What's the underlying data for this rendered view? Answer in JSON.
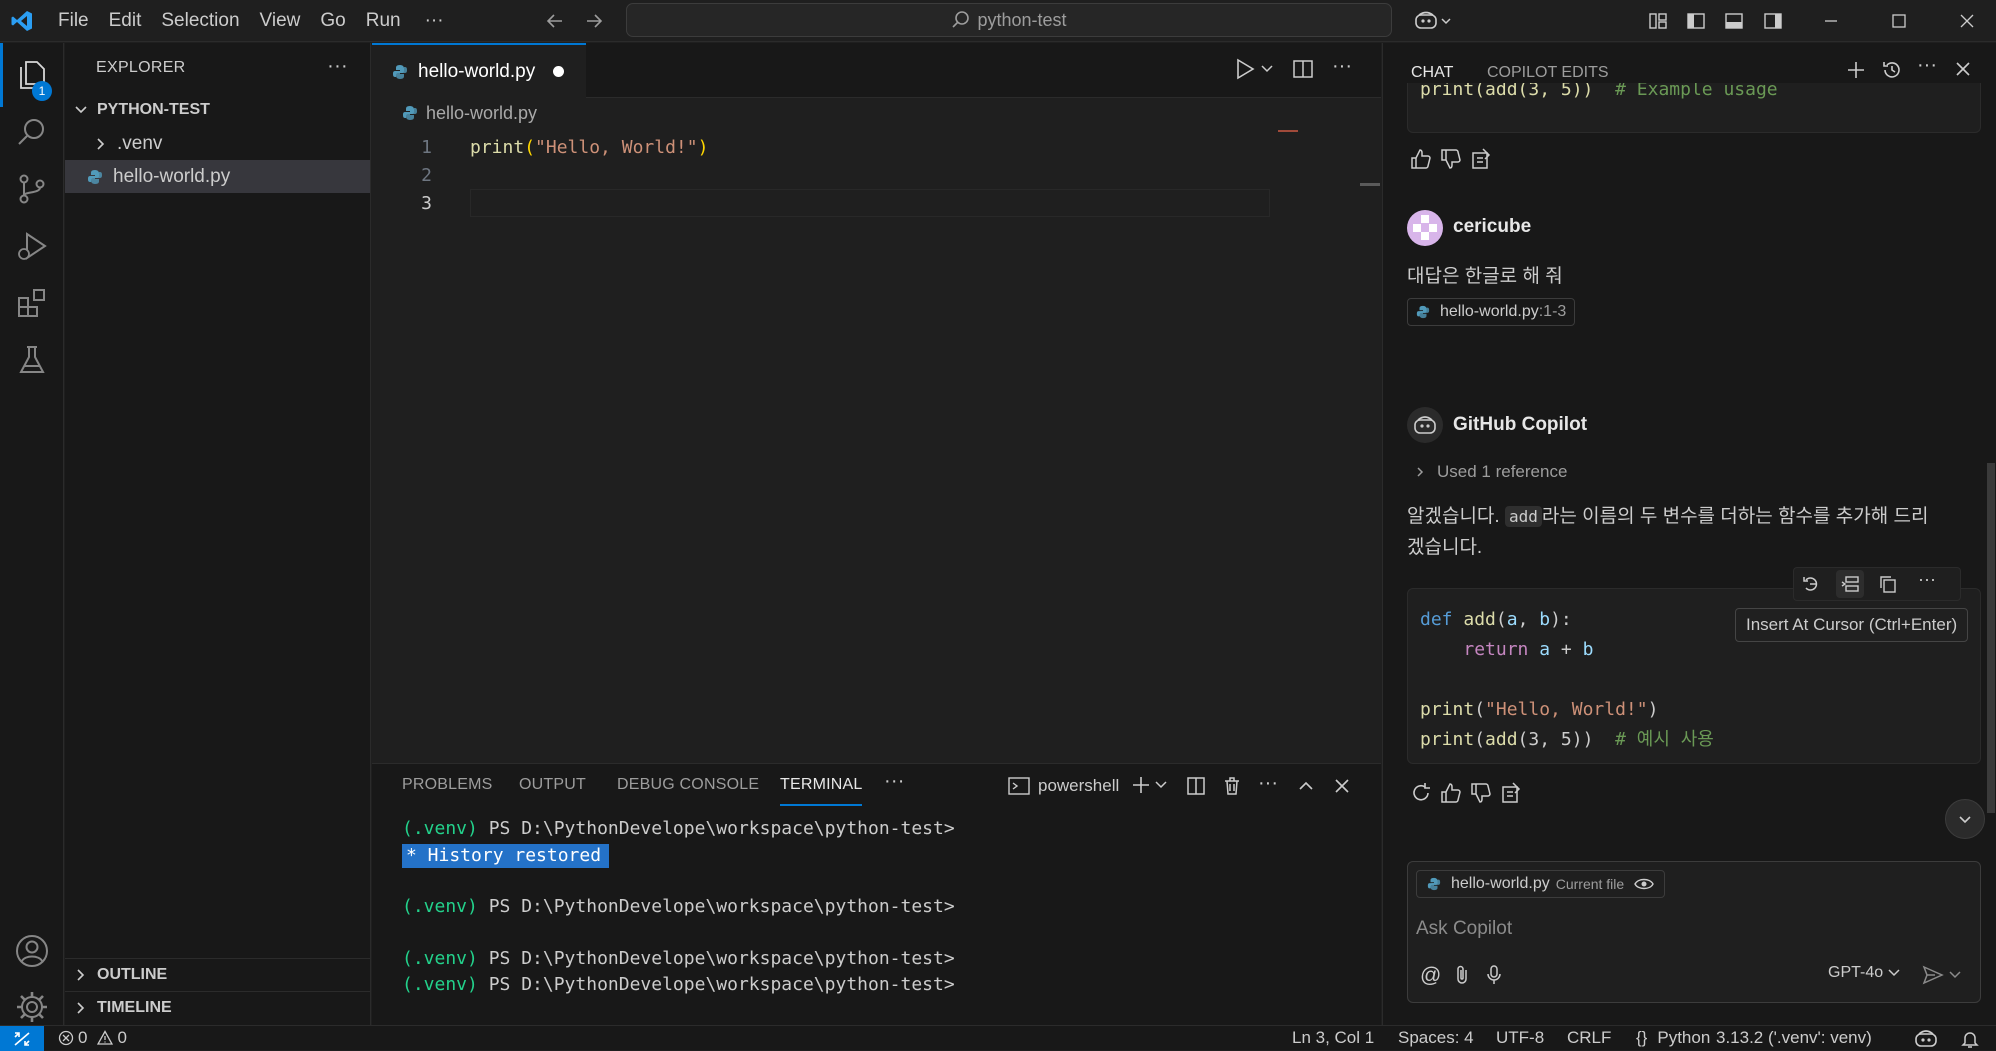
{
  "menu": {
    "file": "File",
    "edit": "Edit",
    "selection": "Selection",
    "view": "View",
    "go": "Go",
    "run": "Run",
    "more": "···"
  },
  "command_center": {
    "text": "python-test"
  },
  "activity": {
    "explorer_badge": "1"
  },
  "sidebar": {
    "title": "EXPLORER",
    "more": "···",
    "folder": "PYTHON-TEST",
    "items": [
      {
        "label": ".venv"
      },
      {
        "label": "hello-world.py"
      }
    ],
    "outline": "OUTLINE",
    "timeline": "TIMELINE"
  },
  "editor": {
    "tab_label": "hello-world.py",
    "breadcrumb": "hello-world.py",
    "lines": [
      {
        "n": "1",
        "code_fn": "print",
        "code_open": "(",
        "code_str": "\"Hello, World!\"",
        "code_close": ")"
      },
      {
        "n": "2"
      },
      {
        "n": "3"
      }
    ]
  },
  "panel": {
    "tabs": [
      "PROBLEMS",
      "OUTPUT",
      "DEBUG CONSOLE",
      "TERMINAL"
    ],
    "more": "···",
    "shell": "powershell",
    "terminal": {
      "prompt_env": "(.venv)",
      "prompt_path": "PS D:\\PythonDevelope\\workspace\\python-test>",
      "history": "* History restored"
    }
  },
  "chat": {
    "tabs": [
      "CHAT",
      "COPILOT EDITS"
    ],
    "top_snippet_fn": "print",
    "top_snippet_args": "(add(3, 5))",
    "top_snippet_comment": "# Example usage",
    "user_name": "cericube",
    "user_message": "대답은 한글로 해 줘",
    "user_ref_file": "hello-world.py",
    "user_ref_lines": ":1-3",
    "bot_name": "GitHub Copilot",
    "used_ref": "Used 1 reference",
    "answer_pre": "알겠습니다.",
    "answer_code": "add",
    "answer_post1": "라는 이름의 두 변수를 더하는 함수를 추가해 드리",
    "answer_post2": "겠습니다.",
    "tooltip": "Insert At Cursor (Ctrl+Enter)",
    "code": {
      "l1_kw": "def",
      "l1_fn": "add",
      "l1_rest1": "(",
      "l1_a": "a",
      "l1_sep": ", ",
      "l1_b": "b",
      "l1_rest2": "):",
      "l2_kw": "return",
      "l2_a": "a",
      "l2_op": " + ",
      "l2_b": "b",
      "l4_fn": "print",
      "l4_open": "(",
      "l4_str": "\"Hello, World!\"",
      "l4_close": ")",
      "l5_fn": "print",
      "l5_open": "(",
      "l5_fn2": "add",
      "l5_args": "(3, 5))",
      "l5_comment": "# 예시 사용"
    },
    "input_file": "hello-world.py",
    "input_file_tag": "Current file",
    "input_placeholder": "Ask Copilot",
    "model": "GPT-4o"
  },
  "status": {
    "errors": "0",
    "warnings": "0",
    "position": "Ln 3, Col 1",
    "spaces": "Spaces: 4",
    "encoding": "UTF-8",
    "eol": "CRLF",
    "lang": "Python",
    "interpreter": "3.13.2 ('.venv': venv)"
  },
  "colors": {
    "accent": "#0078d4",
    "string": "#ce9178",
    "function": "#dcdcaa",
    "keyword": "#569cd6",
    "control": "#c586c0",
    "variable": "#9cdcfe",
    "comment": "#6a9955",
    "terminal_green": "#23d18b"
  }
}
